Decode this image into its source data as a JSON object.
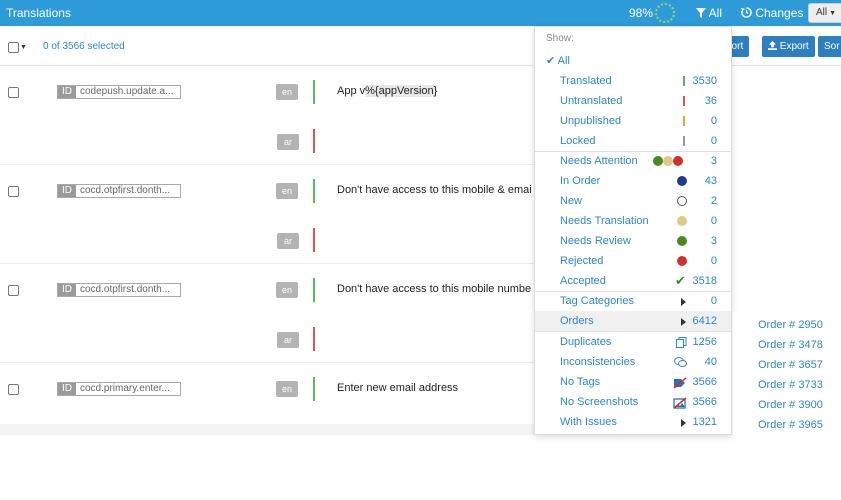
{
  "topbar": {
    "title": "Translations",
    "progress": "98%",
    "filter_label": "All",
    "changes_label": "Changes",
    "select_value": "All"
  },
  "toolbar": {
    "selected_text": "0 of 3566 selected",
    "buttons": [
      "port",
      "Export",
      "Sor"
    ]
  },
  "rows": [
    {
      "id": "codepush.update.a...",
      "langs": [
        "en",
        "ar"
      ],
      "text_prefix": "App v",
      "text_highlight": "%{appVersion}"
    },
    {
      "id": "cocd.otpfirst.donth...",
      "langs": [
        "en",
        "ar"
      ],
      "text": "Don't have access to this mobile & emai"
    },
    {
      "id": "cocd.otpfirst.donth...",
      "langs": [
        "en",
        "ar"
      ],
      "text": "Don't have access to this mobile numbe"
    },
    {
      "id": "cocd.primary.enter...",
      "langs": [
        "en"
      ],
      "text": "Enter new email address"
    }
  ],
  "id_tag": "ID",
  "menu": {
    "show_label": "Show:",
    "all_label": "All",
    "items": [
      {
        "label": "Translated",
        "count": "3530",
        "icon": "green-bar"
      },
      {
        "label": "Untranslated",
        "count": "36",
        "icon": "red-bar"
      },
      {
        "label": "Unpublished",
        "count": "0",
        "icon": "orange-bar"
      },
      {
        "label": "Locked",
        "count": "0",
        "icon": "gray-bar"
      },
      {
        "label": "Needs Attention",
        "count": "3",
        "icon": "three-dots"
      },
      {
        "label": "In Order",
        "count": "43",
        "icon": "navy-dot"
      },
      {
        "label": "New",
        "count": "2",
        "icon": "hollow-dot"
      },
      {
        "label": "Needs Translation",
        "count": "0",
        "icon": "tan-dot"
      },
      {
        "label": "Needs Review",
        "count": "3",
        "icon": "green-dot"
      },
      {
        "label": "Rejected",
        "count": "0",
        "icon": "red-dot"
      },
      {
        "label": "Accepted",
        "count": "3518",
        "icon": "check-icon"
      },
      {
        "label": "Tag Categories",
        "count": "0",
        "icon": "arrow-right"
      },
      {
        "label": "Orders",
        "count": "6412",
        "icon": "arrow-right"
      },
      {
        "label": "Duplicates",
        "count": "1256",
        "icon": "copy-icon"
      },
      {
        "label": "Inconsistencies",
        "count": "40",
        "icon": "chat-icon"
      },
      {
        "label": "No Tags",
        "count": "3566",
        "icon": "no-tag-icon"
      },
      {
        "label": "No Screenshots",
        "count": "3566",
        "icon": "no-image-icon"
      },
      {
        "label": "With Issues",
        "count": "1321",
        "icon": "arrow-right"
      }
    ]
  },
  "orders_submenu": [
    "Order # 2950",
    "Order # 3478",
    "Order # 3657",
    "Order # 3733",
    "Order # 3900",
    "Order # 3965"
  ],
  "colors": {
    "topbar": "#2d9bd8",
    "link": "#2d87c4",
    "green": "#5cb85c",
    "red": "#e05252",
    "navy": "#1f3b8c",
    "tan": "#e0c78a",
    "orange": "#f0a030"
  }
}
